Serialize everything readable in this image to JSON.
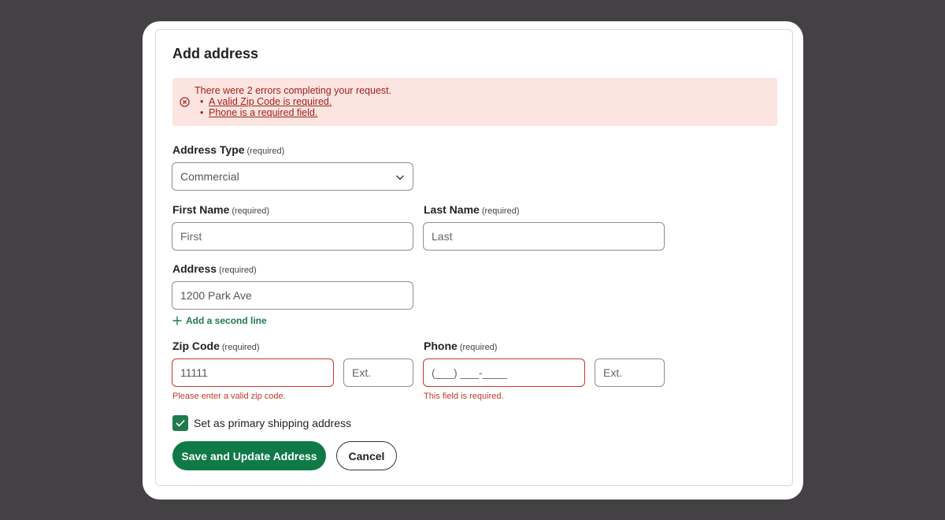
{
  "dialog": {
    "title": "Add address"
  },
  "errors": {
    "heading": "There were 2 errors completing your request.",
    "items": [
      "A valid Zip Code is required.",
      "Phone is a required field."
    ],
    "bullet": "•"
  },
  "form": {
    "required_note": "(required)",
    "address_type": {
      "label": "Address Type",
      "value": "Commercial"
    },
    "first_name": {
      "label": "First Name",
      "placeholder": "First"
    },
    "last_name": {
      "label": "Last Name",
      "placeholder": "Last"
    },
    "address": {
      "label": "Address",
      "value": "1200 Park Ave",
      "add_line": "Add a second line"
    },
    "zip": {
      "label": "Zip Code",
      "value": "11111",
      "ext_placeholder": "Ext.",
      "error": "Please enter a valid zip code."
    },
    "phone": {
      "label": "Phone",
      "placeholder": "(___) ___-____",
      "ext_placeholder": "Ext.",
      "error": "This field is required."
    },
    "primary_checkbox": {
      "label": "Set as primary shipping address",
      "checked": true
    }
  },
  "actions": {
    "save": "Save and Update Address",
    "cancel": "Cancel"
  },
  "colors": {
    "accent": "#0f7a48",
    "error": "#c8362c",
    "error_bg": "#fce4e0",
    "backdrop": "#434143"
  },
  "icons": {
    "error": "error-circle-x-icon",
    "chevron": "chevron-down-icon",
    "plus": "plus-icon",
    "check": "check-icon"
  }
}
